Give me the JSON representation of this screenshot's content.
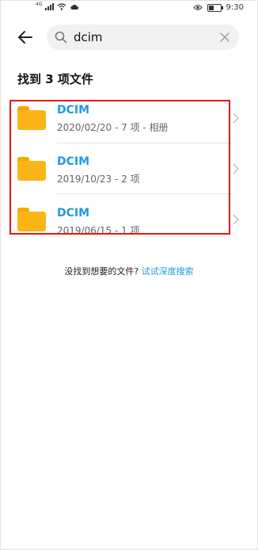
{
  "status_bar": {
    "network": "4G",
    "time": "9:30"
  },
  "search": {
    "query": "dcim"
  },
  "results": {
    "title": "找到 3 项文件",
    "items": [
      {
        "name": "DCIM",
        "meta": "2020/02/20 - 7 项 - 相册"
      },
      {
        "name": "DCIM",
        "meta": "2019/10/23 - 2 项"
      },
      {
        "name": "DCIM",
        "meta": "2019/06/15 - 1 项"
      }
    ]
  },
  "hint": {
    "text": "没找到想要的文件?",
    "link": "试试深度搜索"
  },
  "colors": {
    "accent": "#1e9be3",
    "folder": "#fbb516",
    "highlight": "#e01818"
  }
}
